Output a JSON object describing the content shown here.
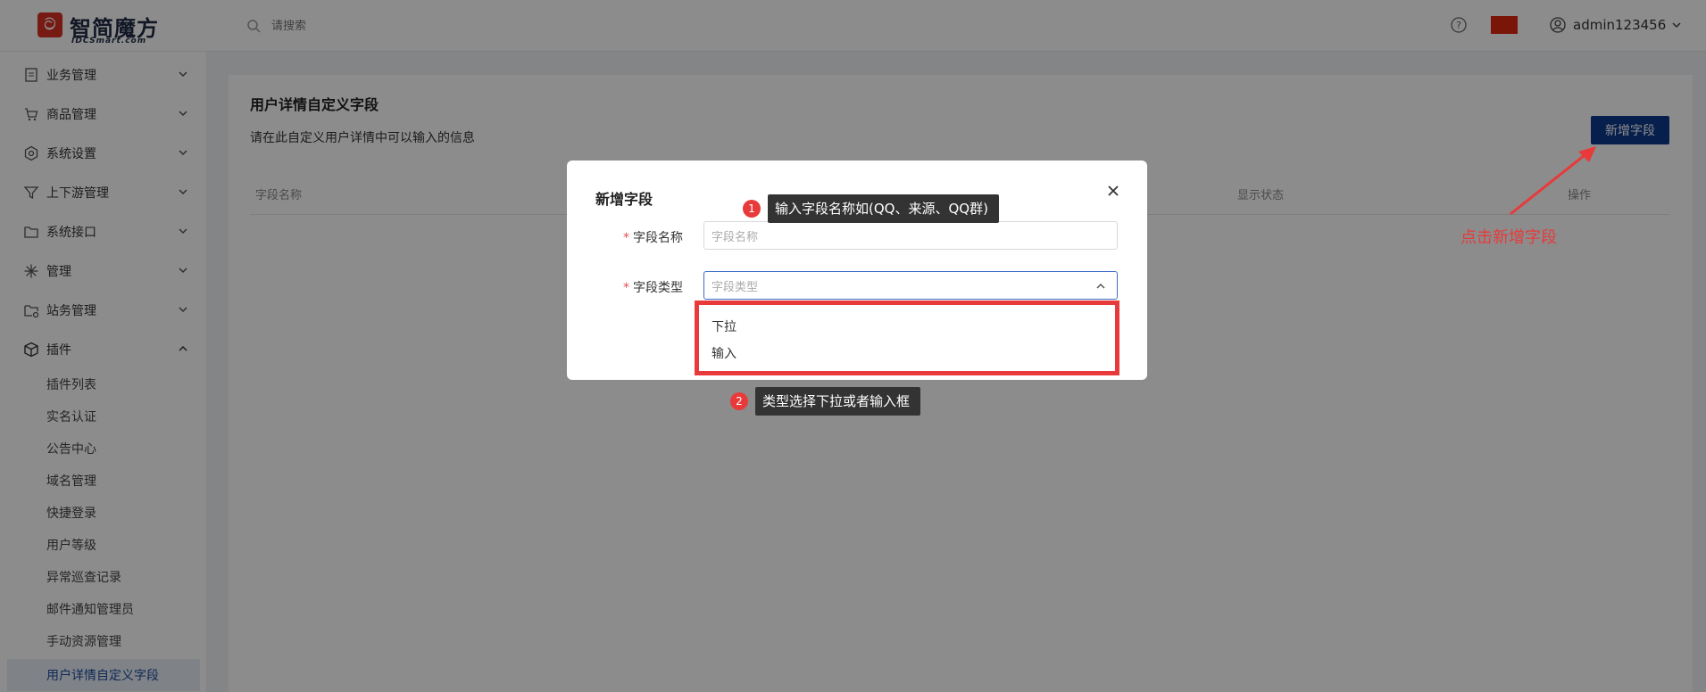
{
  "header": {
    "logo_title": "智简魔方",
    "logo_sub": "IDCSmart.com",
    "search_placeholder": "请搜索",
    "username": "admin123456",
    "flag_color": "#de2910"
  },
  "sidebar": {
    "menu": [
      {
        "label": "业务管理",
        "icon": "document-icon"
      },
      {
        "label": "商品管理",
        "icon": "cart-icon"
      },
      {
        "label": "系统设置",
        "icon": "gear-icon"
      },
      {
        "label": "上下游管理",
        "icon": "filter-icon"
      },
      {
        "label": "系统接口",
        "icon": "folder-icon"
      },
      {
        "label": "管理",
        "icon": "asterisk-icon"
      },
      {
        "label": "站务管理",
        "icon": "site-icon"
      },
      {
        "label": "插件",
        "icon": "package-icon"
      }
    ],
    "sub_items": [
      "插件列表",
      "实名认证",
      "公告中心",
      "域名管理",
      "快捷登录",
      "用户等级",
      "异常巡查记录",
      "邮件通知管理员",
      "手动资源管理",
      "用户详情自定义字段"
    ]
  },
  "main": {
    "title": "用户详情自定义字段",
    "description": "请在此自定义用户详情中可以输入的信息",
    "add_button": "新增字段",
    "columns": [
      "字段名称",
      "显示状态",
      "操作"
    ]
  },
  "modal": {
    "title": "新增字段",
    "required_mark": "*",
    "name_label": "字段名称",
    "name_placeholder": "字段名称",
    "type_label": "字段类型",
    "type_placeholder": "字段类型",
    "type_options": [
      "下拉",
      "输入"
    ]
  },
  "annotations": {
    "tip1_num": "1",
    "tip1_text": "输入字段名称如(QQ、来源、QQ群)",
    "tip2_num": "2",
    "tip2_text": "类型选择下拉或者输入框",
    "red_note": "点击新增字段",
    "accent_color": "#e83a3a"
  }
}
